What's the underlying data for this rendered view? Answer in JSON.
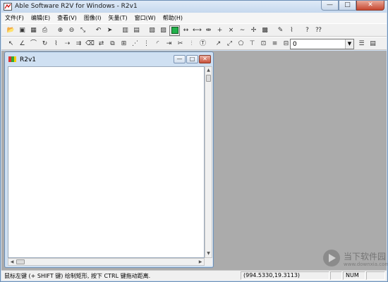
{
  "app": {
    "title": "Able Software R2V for Windows - R2v1"
  },
  "window_controls": {
    "minimize": "—",
    "maximize": "□",
    "close": "✕"
  },
  "menu": {
    "items": [
      {
        "label": "文件(F)"
      },
      {
        "label": "编辑(E)"
      },
      {
        "label": "查看(V)"
      },
      {
        "label": "图像(I)"
      },
      {
        "label": "矢量(T)"
      },
      {
        "label": "窗口(W)"
      },
      {
        "label": "帮助(H)"
      }
    ]
  },
  "toolbar1": {
    "icons": [
      "open-folder-icon",
      "save-icon",
      "open-image-icon",
      "print-icon",
      "sep",
      "zoom-in-icon",
      "zoom-out-icon",
      "zoom-window-icon",
      "sep",
      "undo-icon",
      "select-arrow-icon",
      "sep",
      "toggle-grid-icon",
      "toggle-raster-icon",
      "sep",
      "thin-icon",
      "thick-icon",
      "color-fill-icon",
      "line-split-icon",
      "join-node-icon",
      "move-node-icon",
      "add-node-icon",
      "delete-node-icon",
      "smooth-icon",
      "snap-icon",
      "close-polygon-icon",
      "sep",
      "pick-color-icon",
      "trace-icon",
      "sep",
      "help-icon",
      "context-help-icon"
    ]
  },
  "toolbar2": {
    "icons": [
      "edit-pointer-icon",
      "add-line-icon",
      "add-curve-icon",
      "rotate-icon",
      "connect-icon",
      "split-icon",
      "join-icon",
      "delete-segment-icon",
      "reverse-icon",
      "copy-icon",
      "group-icon",
      "break-icon",
      "merge-icon",
      "fillet-icon",
      "extend-icon",
      "trim-icon",
      "offset-icon",
      "label-icon",
      "sep",
      "select-node-icon",
      "select-line-icon",
      "select-polygon-icon",
      "select-text-icon",
      "select-all-icon",
      "select-level-icon",
      "set-value-icon"
    ],
    "level_value": "0",
    "right_icons": [
      "level-list-icon",
      "level-table-icon"
    ]
  },
  "child_window": {
    "title": "R2v1"
  },
  "statusbar": {
    "message": "鼠标左键 (+ SHIFT 键) 绘制矩形, 按下 CTRL 键拖动距离.",
    "coordinates": "(994.5330,19.3113)",
    "num": "NUM"
  },
  "watermark": {
    "name": "当下软件园",
    "url": "www.downxia.com"
  },
  "colors": {
    "mdi_background": "#ababab",
    "frame": "#cfe0f2",
    "close_button": "#c6462f",
    "layer_toggle_green": "#22b14c"
  }
}
